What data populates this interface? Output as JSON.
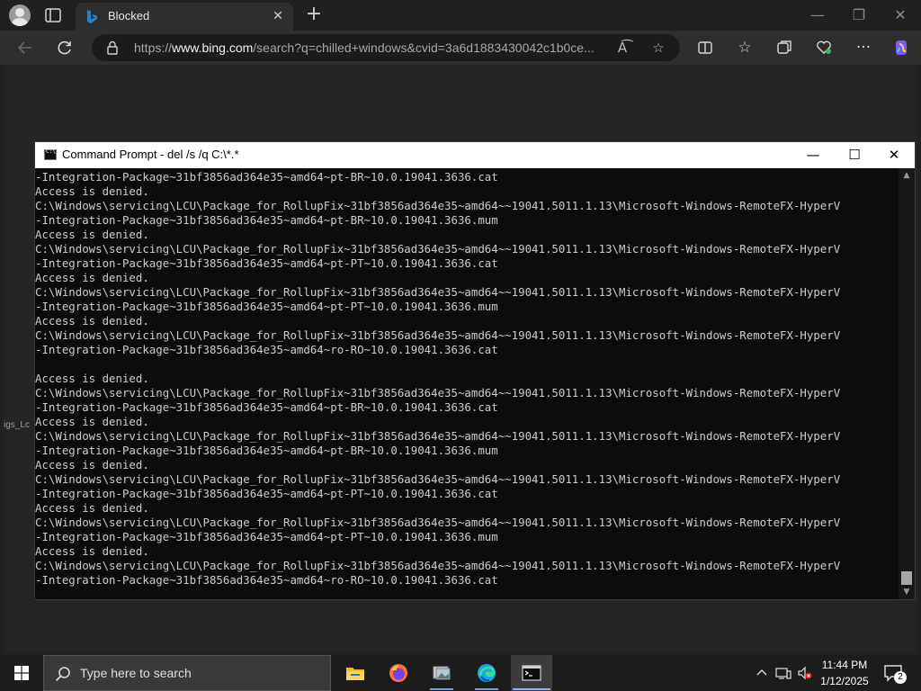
{
  "browser": {
    "tab": {
      "title": "Blocked"
    },
    "address": {
      "url_prefix": "https://",
      "url_domain": "www.bing.com",
      "url_path": "/search?q=chilled+windows&cvid=3a6d1883430042c1b0ce..."
    },
    "icons": [
      "profile-avatar",
      "tab-actions-icon",
      "bing-favicon",
      "close-icon",
      "plus-icon",
      "back-arrow-icon",
      "refresh-icon",
      "lock-icon",
      "read-aloud-icon",
      "star-icon",
      "split-screen-icon",
      "favorites-icon",
      "collections-icon",
      "browser-essentials-icon",
      "more-icon",
      "copilot-icon"
    ]
  },
  "desktop": {
    "label": "igs_Lc"
  },
  "cmd": {
    "title": "Command Prompt - del  /s /q C:\\*.*",
    "lines": [
      "-Integration-Package~31bf3856ad364e35~amd64~pt-BR~10.0.19041.3636.cat",
      "Access is denied.",
      "C:\\Windows\\servicing\\LCU\\Package_for_RollupFix~31bf3856ad364e35~amd64~~19041.5011.1.13\\Microsoft-Windows-RemoteFX-HyperV",
      "-Integration-Package~31bf3856ad364e35~amd64~pt-BR~10.0.19041.3636.mum",
      "Access is denied.",
      "C:\\Windows\\servicing\\LCU\\Package_for_RollupFix~31bf3856ad364e35~amd64~~19041.5011.1.13\\Microsoft-Windows-RemoteFX-HyperV",
      "-Integration-Package~31bf3856ad364e35~amd64~pt-PT~10.0.19041.3636.cat",
      "Access is denied.",
      "C:\\Windows\\servicing\\LCU\\Package_for_RollupFix~31bf3856ad364e35~amd64~~19041.5011.1.13\\Microsoft-Windows-RemoteFX-HyperV",
      "-Integration-Package~31bf3856ad364e35~amd64~pt-PT~10.0.19041.3636.mum",
      "Access is denied.",
      "C:\\Windows\\servicing\\LCU\\Package_for_RollupFix~31bf3856ad364e35~amd64~~19041.5011.1.13\\Microsoft-Windows-RemoteFX-HyperV",
      "-Integration-Package~31bf3856ad364e35~amd64~ro-RO~10.0.19041.3636.cat",
      "",
      "Access is denied.",
      "C:\\Windows\\servicing\\LCU\\Package_for_RollupFix~31bf3856ad364e35~amd64~~19041.5011.1.13\\Microsoft-Windows-RemoteFX-HyperV",
      "-Integration-Package~31bf3856ad364e35~amd64~pt-BR~10.0.19041.3636.cat",
      "Access is denied.",
      "C:\\Windows\\servicing\\LCU\\Package_for_RollupFix~31bf3856ad364e35~amd64~~19041.5011.1.13\\Microsoft-Windows-RemoteFX-HyperV",
      "-Integration-Package~31bf3856ad364e35~amd64~pt-BR~10.0.19041.3636.mum",
      "Access is denied.",
      "C:\\Windows\\servicing\\LCU\\Package_for_RollupFix~31bf3856ad364e35~amd64~~19041.5011.1.13\\Microsoft-Windows-RemoteFX-HyperV",
      "-Integration-Package~31bf3856ad364e35~amd64~pt-PT~10.0.19041.3636.cat",
      "Access is denied.",
      "C:\\Windows\\servicing\\LCU\\Package_for_RollupFix~31bf3856ad364e35~amd64~~19041.5011.1.13\\Microsoft-Windows-RemoteFX-HyperV",
      "-Integration-Package~31bf3856ad364e35~amd64~pt-PT~10.0.19041.3636.mum",
      "Access is denied.",
      "C:\\Windows\\servicing\\LCU\\Package_for_RollupFix~31bf3856ad364e35~amd64~~19041.5011.1.13\\Microsoft-Windows-RemoteFX-HyperV",
      "-Integration-Package~31bf3856ad364e35~amd64~ro-RO~10.0.19041.3636.cat"
    ]
  },
  "taskbar": {
    "search_placeholder": "Type here to search",
    "apps": [
      "file-explorer-icon",
      "firefox-icon",
      "photos-icon",
      "edge-icon",
      "command-prompt-icon"
    ],
    "clock": {
      "time": "11:44 PM",
      "date": "1/12/2025"
    },
    "notification_count": "2"
  },
  "colors": {
    "accent": "#8fb4e3",
    "console_bg": "#0c0c0c",
    "console_text": "#cccccc",
    "bing_blue": "#1b8ad6",
    "copilot": "#7a5cff"
  }
}
